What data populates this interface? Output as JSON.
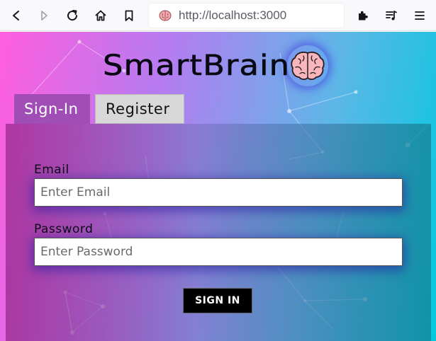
{
  "browser": {
    "url": "http://localhost:3000",
    "icons": [
      "back-icon",
      "forward-icon",
      "reload-icon",
      "home-icon",
      "bookmark-icon",
      "extensions-icon",
      "media-queue-icon",
      "menu-icon"
    ]
  },
  "app": {
    "title": "SmartBrain",
    "logo_icon": "brain-icon"
  },
  "tabs": [
    {
      "label": "Sign-In",
      "active": true
    },
    {
      "label": "Register",
      "active": false
    }
  ],
  "form": {
    "email_label": "Email",
    "email_placeholder": "Enter Email",
    "password_label": "Password",
    "password_placeholder": "Enter Password",
    "submit_label": "SIGN IN"
  },
  "colors": {
    "active_tab": "#a14db6",
    "inactive_tab": "#d8d8d8",
    "button": "#000000"
  }
}
